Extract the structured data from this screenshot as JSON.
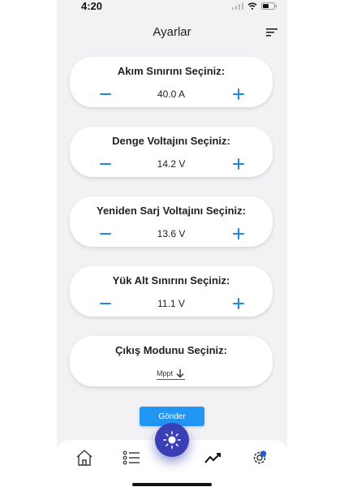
{
  "status_bar": {
    "time": "4:20"
  },
  "header": {
    "title": "Ayarlar"
  },
  "settings": [
    {
      "title": "Akım Sınırını Seçiniz:",
      "value": "40.0 A"
    },
    {
      "title": "Denge Voltajını Seçiniz:",
      "value": "14.2 V"
    },
    {
      "title": "Yeniden Sarj Voltajını Seçiniz:",
      "value": "13.6 V"
    },
    {
      "title": "Yük Alt Sınırını Seçiniz:",
      "value": "11.1 V"
    }
  ],
  "output_mode": {
    "title": "Çıkış Modunu Seçiniz:",
    "selected": "Mppt"
  },
  "submit": {
    "label": "Gönder"
  },
  "colors": {
    "accent": "#1e88e5",
    "fab": "#3a3fb5",
    "select_underline": "#6a3ab2",
    "background": "#f2f2f5"
  },
  "nav": {
    "items": [
      "home-icon",
      "list-icon",
      "sun-icon",
      "trend-icon",
      "settings-icon"
    ]
  }
}
